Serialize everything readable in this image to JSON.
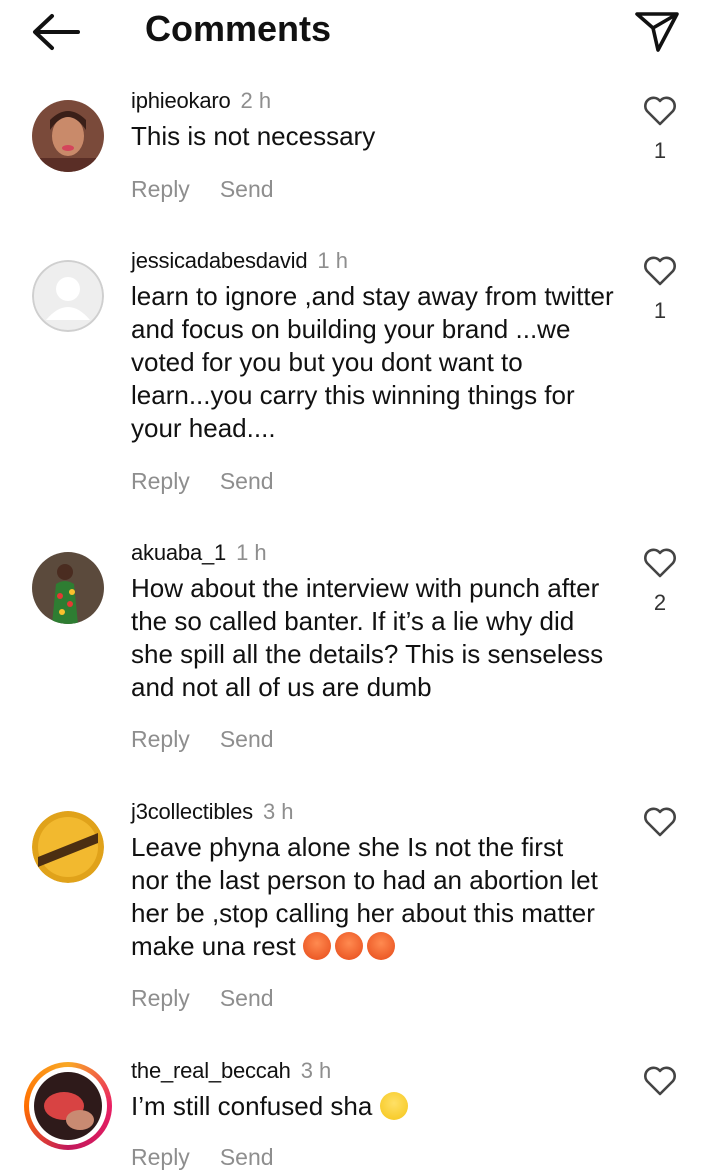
{
  "header": {
    "title": "Comments",
    "back_icon": "arrow-left-icon",
    "share_icon": "paper-plane-icon"
  },
  "comments": [
    {
      "username": "iphieokaro",
      "time": "2 h",
      "text": "This is not necessary",
      "likes": "1",
      "reply_label": "Reply",
      "send_label": "Send"
    },
    {
      "username": "jessicadabesdavid",
      "time": "1 h",
      "text": "learn to ignore ,and stay away from twitter and focus on building  your brand ...we voted for you but you dont want to learn...you carry this winning things for your head....",
      "likes": "1",
      "reply_label": "Reply",
      "send_label": "Send"
    },
    {
      "username": "akuaba_1",
      "time": "1 h",
      "text": "How about the interview with punch after the so called banter. If it’s a lie why did she spill all the details? This is senseless and not all of us are dumb",
      "likes": "2",
      "reply_label": "Reply",
      "send_label": "Send"
    },
    {
      "username": "j3collectibles",
      "time": "3 h",
      "text": "Leave phyna alone she Is not the first nor the last person to had an abortion let her be ,stop calling her about this matter make una rest",
      "emojis": [
        "angry-face-emoji",
        "angry-face-emoji",
        "angry-face-emoji"
      ],
      "likes": "",
      "reply_label": "Reply",
      "send_label": "Send"
    },
    {
      "username": "the_real_beccah",
      "time": "3 h",
      "text": "I’m still confused sha",
      "emojis": [
        "smiling-face-with-tear-emoji"
      ],
      "likes": "",
      "reply_label": "Reply",
      "send_label": "Send"
    }
  ]
}
